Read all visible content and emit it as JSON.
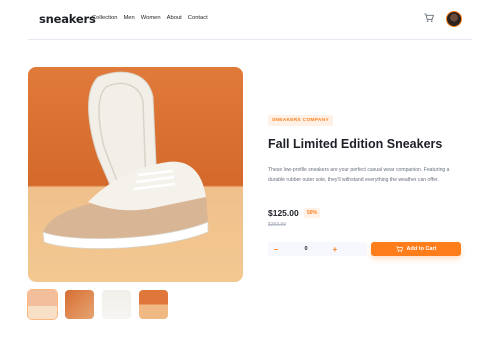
{
  "header": {
    "logo": "sneakers",
    "nav": [
      "Collection",
      "Men",
      "Women",
      "About",
      "Contact"
    ]
  },
  "product": {
    "company": "SNEAKERS COMPANY",
    "title": "Fall Limited Edition Sneakers",
    "description": "These low-profile sneakers are your perfect casual wear companion. Featuring a durable rubber outer sole, they'll withstand everything the weather can offer.",
    "price": "$125.00",
    "discount": "50%",
    "old_price": "$250.00"
  },
  "cart": {
    "quantity": "0",
    "minus": "−",
    "plus": "+",
    "add_label": "Add to Cart"
  },
  "icons": {
    "cart": "cart-icon",
    "avatar": "user-avatar"
  },
  "colors": {
    "accent": "#ff7e1b",
    "accent_light": "#fff1e6",
    "text_dark": "#1d2026",
    "text_muted": "#69707d"
  }
}
